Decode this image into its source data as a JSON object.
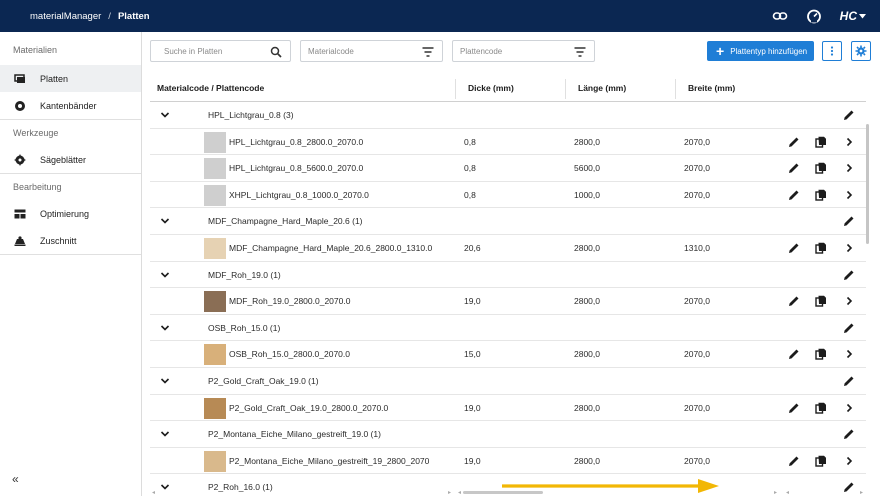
{
  "header": {
    "app_name": "materialManager",
    "separator": "/",
    "page_name": "Platten",
    "brand": "HC"
  },
  "sidebar": {
    "sections": [
      {
        "title": "Materialien",
        "items": [
          {
            "label": "Platten",
            "icon": "board-icon",
            "active": true
          },
          {
            "label": "Kantenbänder",
            "icon": "edge-tape-icon",
            "active": false
          }
        ]
      },
      {
        "title": "Werkzeuge",
        "items": [
          {
            "label": "Sägeblätter",
            "icon": "saw-blade-icon",
            "active": false
          }
        ]
      },
      {
        "title": "Bearbeitung",
        "items": [
          {
            "label": "Optimierung",
            "icon": "optimization-icon",
            "active": false
          },
          {
            "label": "Zuschnitt",
            "icon": "cutting-icon",
            "active": false
          }
        ]
      }
    ],
    "collapse_label": "«"
  },
  "toolbar": {
    "search_placeholder": "Suche in Platten",
    "filter_material_placeholder": "Materialcode",
    "filter_plate_placeholder": "Plattencode",
    "add_button_label": "Plattentyp hinzufügen",
    "accent_color": "#1f7ed6"
  },
  "table": {
    "headers": [
      "Materialcode / Plattencode",
      "Dicke (mm)",
      "Länge (mm)",
      "Breite (mm)"
    ],
    "groups": [
      {
        "name": "HPL_Lichtgrau_0.8 (3)",
        "rows": [
          {
            "code": "HPL_Lichtgrau_0.8_2800.0_2070.0",
            "dicke": "0,8",
            "laenge": "2800,0",
            "breite": "2070,0",
            "thumb": "#cfcfcf"
          },
          {
            "code": "HPL_Lichtgrau_0.8_5600.0_2070.0",
            "dicke": "0,8",
            "laenge": "5600,0",
            "breite": "2070,0",
            "thumb": "#cfcfcf"
          },
          {
            "code": "XHPL_Lichtgrau_0.8_1000.0_2070.0",
            "dicke": "0,8",
            "laenge": "1000,0",
            "breite": "2070,0",
            "thumb": "#cfcfcf"
          }
        ]
      },
      {
        "name": "MDF_Champagne_Hard_Maple_20.6 (1)",
        "rows": [
          {
            "code": "MDF_Champagne_Hard_Maple_20.6_2800.0_1310.0",
            "dicke": "20,6",
            "laenge": "2800,0",
            "breite": "1310,0",
            "thumb": "#e6d2b3"
          }
        ]
      },
      {
        "name": "MDF_Roh_19.0 (1)",
        "rows": [
          {
            "code": "MDF_Roh_19.0_2800.0_2070.0",
            "dicke": "19,0",
            "laenge": "2800,0",
            "breite": "2070,0",
            "thumb": "#8a6e55"
          }
        ]
      },
      {
        "name": "OSB_Roh_15.0 (1)",
        "rows": [
          {
            "code": "OSB_Roh_15.0_2800.0_2070.0",
            "dicke": "15,0",
            "laenge": "2800,0",
            "breite": "2070,0",
            "thumb": "#d8b07a"
          }
        ]
      },
      {
        "name": "P2_Gold_Craft_Oak_19.0 (1)",
        "rows": [
          {
            "code": "P2_Gold_Craft_Oak_19.0_2800.0_2070.0",
            "dicke": "19,0",
            "laenge": "2800,0",
            "breite": "2070,0",
            "thumb": "#b78a55"
          }
        ]
      },
      {
        "name": "P2_Montana_Eiche_Milano_gestreift_19.0 (1)",
        "rows": [
          {
            "code": "P2_Montana_Eiche_Milano_gestreift_19_2800_2070",
            "dicke": "19,0",
            "laenge": "2800,0",
            "breite": "2070,0",
            "thumb": "#d9b98c"
          }
        ]
      },
      {
        "name": "P2_Roh_16.0 (1)",
        "rows": []
      }
    ]
  }
}
